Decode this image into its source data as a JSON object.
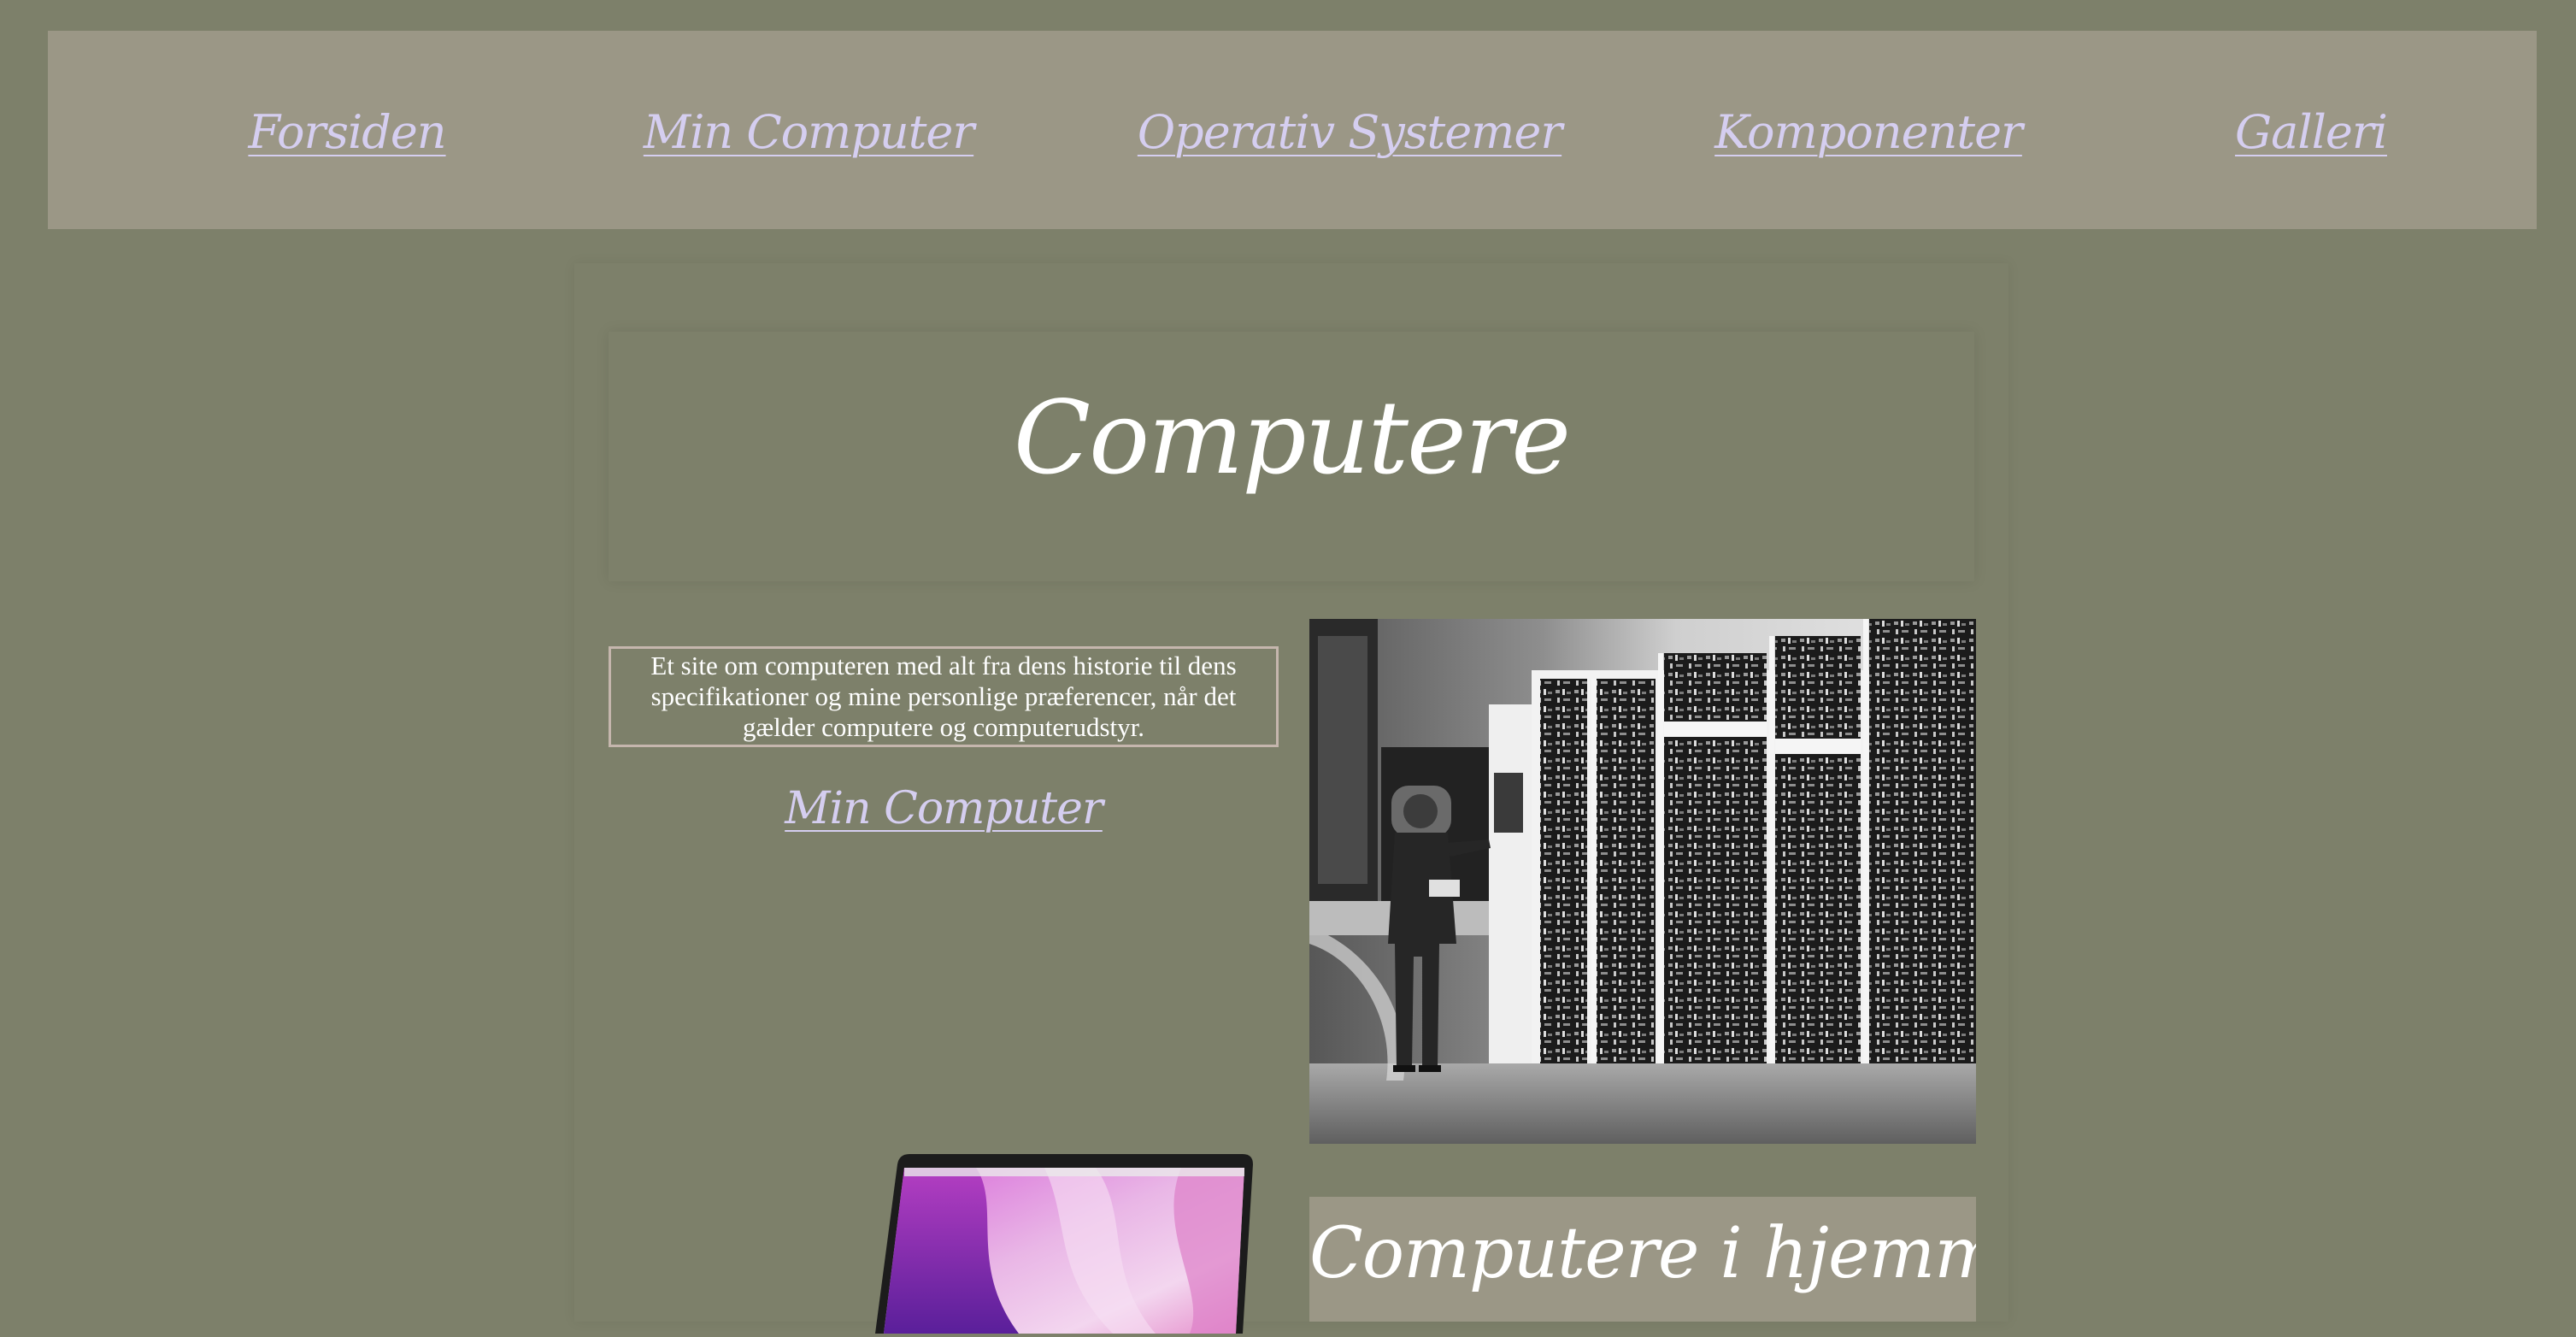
{
  "nav": {
    "items": [
      "Forsiden",
      "Min Computer",
      "Operativ Systemer",
      "Komponenter",
      "Galleri"
    ]
  },
  "hero": {
    "title": "Computere"
  },
  "intro": {
    "text": "Et site om computeren med alt fra dens historie til dens specifikationer og mine personlige præferencer, når det gælder computere og computerudstyr."
  },
  "links": {
    "min_computer": "Min Computer"
  },
  "section": {
    "title": "Computere i hjemmet"
  },
  "colors": {
    "background": "#7d806a",
    "nav_background": "#9b9786",
    "link": "#d5cef0",
    "text": "#ffffff",
    "border": "#c5b6ad"
  },
  "images": {
    "historic_photo": "historic-computer-photo",
    "laptop": "laptop-image"
  }
}
